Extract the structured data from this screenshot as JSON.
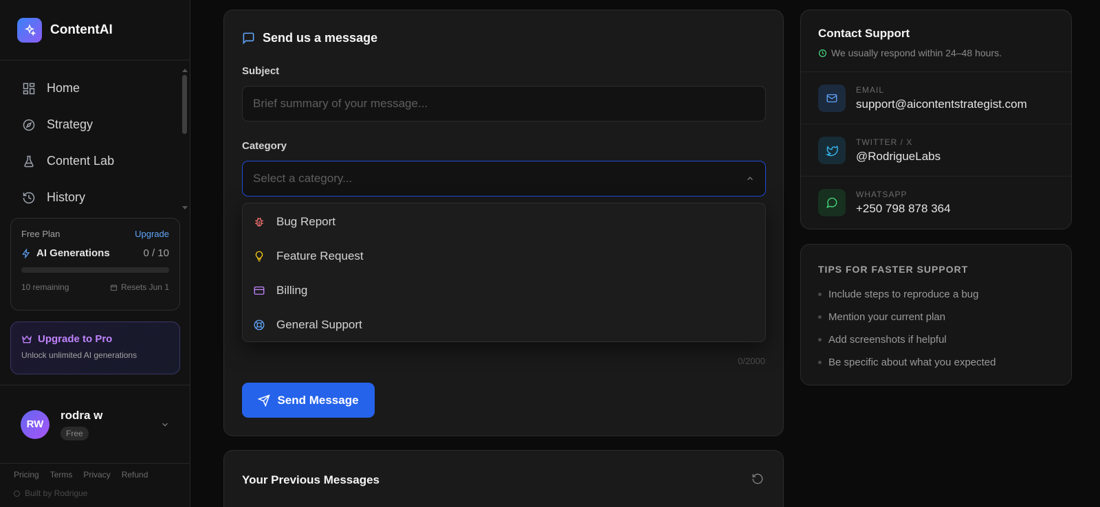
{
  "brand": {
    "name": "ContentAI"
  },
  "nav": [
    {
      "label": "Home",
      "icon": "grid-icon"
    },
    {
      "label": "Strategy",
      "icon": "compass-icon"
    },
    {
      "label": "Content Lab",
      "icon": "flask-icon"
    },
    {
      "label": "History",
      "icon": "history-icon"
    }
  ],
  "plan": {
    "name": "Free Plan",
    "upgrade_label": "Upgrade",
    "generations_label": "AI Generations",
    "generations_count": "0 / 10",
    "usage_fraction": 0,
    "remaining": "10 remaining",
    "resets": "Resets Jun 1"
  },
  "pro": {
    "title": "Upgrade to Pro",
    "subtitle": "Unlock unlimited AI generations"
  },
  "user": {
    "initials": "RW",
    "name": "rodra w",
    "badge": "Free"
  },
  "footer": {
    "links": [
      "Pricing",
      "Terms",
      "Privacy",
      "Refund"
    ],
    "built_by": "Built by Rodrigue"
  },
  "form": {
    "title": "Send us a message",
    "subject_label": "Subject",
    "subject_placeholder": "Brief summary of your message...",
    "category_label": "Category",
    "category_placeholder": "Select a category...",
    "categories": [
      {
        "label": "Bug Report",
        "icon": "bug-icon",
        "color": "#f87171"
      },
      {
        "label": "Feature Request",
        "icon": "lightbulb-icon",
        "color": "#facc15"
      },
      {
        "label": "Billing",
        "icon": "credit-card-icon",
        "color": "#c084fc"
      },
      {
        "label": "General Support",
        "icon": "lifebuoy-icon",
        "color": "#60a5fa"
      }
    ],
    "char_count": "0/2000",
    "send_label": "Send Message"
  },
  "previous": {
    "title": "Your Previous Messages"
  },
  "contact": {
    "title": "Contact Support",
    "subtitle": "We usually respond within 24–48 hours.",
    "channels": [
      {
        "label": "EMAIL",
        "value": "support@aicontentstrategist.com",
        "icon": "mail-icon",
        "color": "#60a5fa"
      },
      {
        "label": "TWITTER / X",
        "value": "@RodrigueLabs",
        "icon": "twitter-icon",
        "color": "#38bdf8"
      },
      {
        "label": "WHATSAPP",
        "value": "+250 798 878 364",
        "icon": "whatsapp-icon",
        "color": "#4ade80"
      }
    ]
  },
  "tips": {
    "title": "TIPS FOR FASTER SUPPORT",
    "items": [
      "Include steps to reproduce a bug",
      "Mention your current plan",
      "Add screenshots if helpful",
      "Be specific about what you expected"
    ]
  },
  "colors": {
    "accent": "#2563eb",
    "background": "#0b0b0b",
    "card": "#1a1a1a"
  }
}
